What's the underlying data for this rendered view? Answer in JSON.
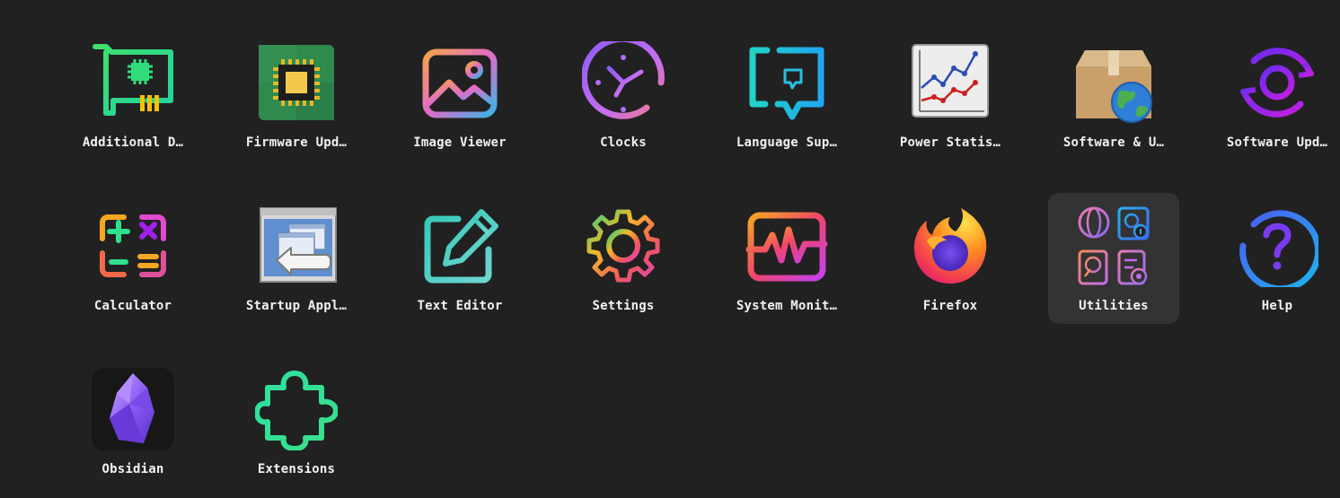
{
  "app_grid": {
    "apps": [
      {
        "label": "Additional D…",
        "icon": "additional-drivers-icon"
      },
      {
        "label": "Firmware Upd…",
        "icon": "firmware-updater-icon"
      },
      {
        "label": "Image Viewer",
        "icon": "image-viewer-icon"
      },
      {
        "label": "Clocks",
        "icon": "clocks-icon"
      },
      {
        "label": "Language Sup…",
        "icon": "language-support-icon"
      },
      {
        "label": "Power Statis…",
        "icon": "power-statistics-icon"
      },
      {
        "label": "Software & U…",
        "icon": "software-updates-icon"
      },
      {
        "label": "Software Upd…",
        "icon": "software-updater-icon"
      },
      {
        "label": "Calculator",
        "icon": "calculator-icon"
      },
      {
        "label": "Startup Appl…",
        "icon": "startup-applications-icon"
      },
      {
        "label": "Text Editor",
        "icon": "text-editor-icon"
      },
      {
        "label": "Settings",
        "icon": "gear-icon"
      },
      {
        "label": "System Monit…",
        "icon": "system-monitor-icon"
      },
      {
        "label": "Firefox",
        "icon": "firefox-icon"
      },
      {
        "label": "Utilities",
        "icon": "utilities-folder-icon",
        "selected": true
      },
      {
        "label": "Help",
        "icon": "help-icon"
      },
      {
        "label": "Obsidian",
        "icon": "obsidian-icon"
      },
      {
        "label": "Extensions",
        "icon": "extensions-icon"
      }
    ]
  },
  "colors": {
    "background": "#212121",
    "selected_tile": "#333334",
    "label_text": "#f2f2f2"
  }
}
